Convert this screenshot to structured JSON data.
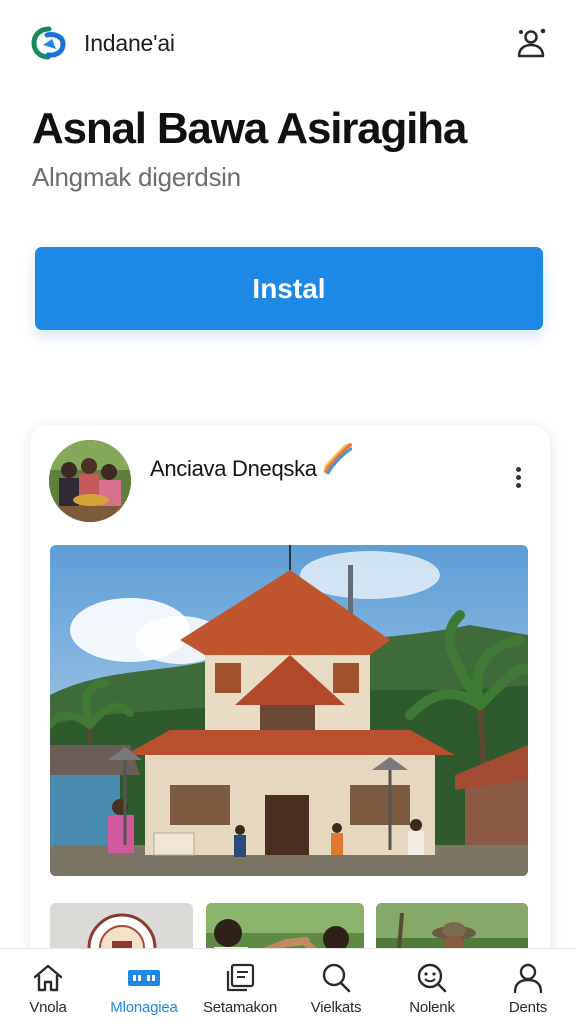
{
  "app": {
    "name": "Indane'ai",
    "logo_icon": "app-logo-icon",
    "action_icon": "people-icon"
  },
  "hero": {
    "title": "Asnal Bawa Asiragiha",
    "subtitle": "Alngmak digerdsin",
    "install_label": "Instal"
  },
  "post": {
    "author": "Anciava Dneqska",
    "author_badge_icon": "flag-icon",
    "more_icon": "more-vertical-icon",
    "image_subject": "traditional-house-photo"
  },
  "bottom_nav": {
    "items": [
      {
        "label": "Vnola",
        "icon": "home-icon",
        "active": false
      },
      {
        "label": "Mlonagiea",
        "icon": "grid-icon",
        "active": true
      },
      {
        "label": "Setamakon",
        "icon": "cards-icon",
        "active": false
      },
      {
        "label": "Vielkats",
        "icon": "search-icon",
        "active": false
      },
      {
        "label": "Nolenk",
        "icon": "discover-icon",
        "active": false
      },
      {
        "label": "Dents",
        "icon": "profile-icon",
        "active": false
      }
    ]
  },
  "colors": {
    "accent": "#1e88e5",
    "text_primary": "#111111",
    "text_secondary": "#6d6d72",
    "roof": "#b24a2a"
  }
}
